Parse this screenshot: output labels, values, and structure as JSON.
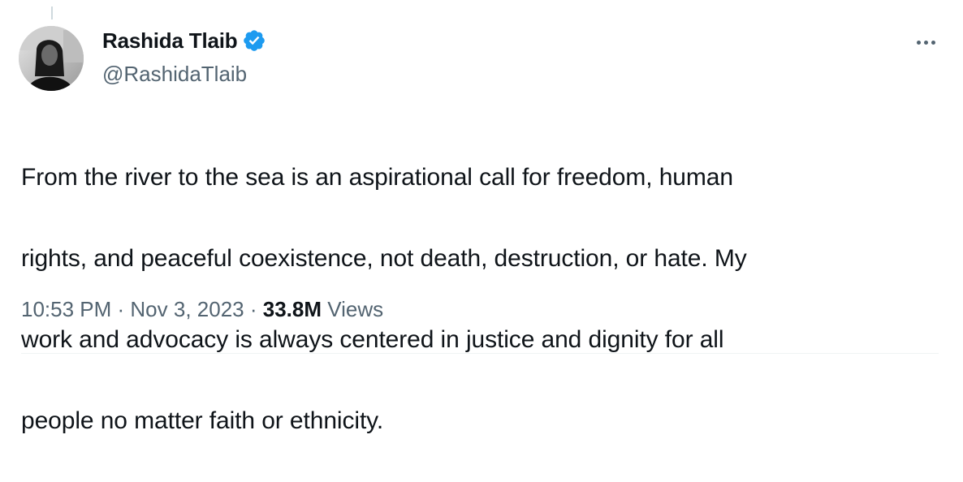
{
  "author": {
    "display_name": "Rashida Tlaib",
    "handle": "@RashidaTlaib",
    "verified": true,
    "avatar_icon": "profile-photo"
  },
  "tweet": {
    "lines": [
      "From the river to the sea is an aspirational call for freedom, human",
      "rights, and peaceful coexistence, not death, destruction, or hate. My",
      "work and advocacy is always centered in justice and dignity for all",
      "people no matter faith or ethnicity."
    ]
  },
  "meta": {
    "time": "10:53 PM",
    "separator": " · ",
    "date": "Nov 3, 2023",
    "views_count": "33.8M",
    "views_label": " Views"
  },
  "colors": {
    "text_primary": "#0f1419",
    "text_secondary": "#536471",
    "verified_blue": "#1d9bf0",
    "divider": "#eff3f4"
  },
  "icons": {
    "verified": "verified-badge-icon",
    "more": "more-options-icon"
  }
}
